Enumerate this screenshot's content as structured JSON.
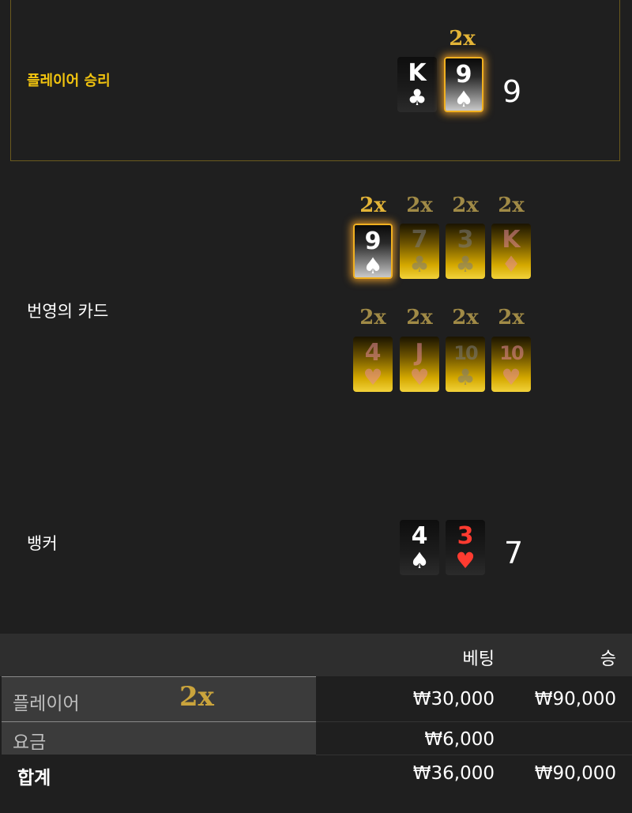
{
  "player": {
    "label": "플레이어 승리",
    "multiplier": "2x",
    "score": "9",
    "cards": [
      {
        "rank": "K",
        "suit": "♣",
        "style": "black",
        "color": "white"
      },
      {
        "rank": "9",
        "suit": "♠",
        "style": "silver",
        "color": "white"
      }
    ]
  },
  "lightning": {
    "label": "번영의 카드",
    "row1": [
      {
        "mult": "2x",
        "rank": "9",
        "suit": "♠",
        "style": "silver",
        "color": "white",
        "active": true
      },
      {
        "mult": "2x",
        "rank": "7",
        "suit": "♣",
        "style": "gold",
        "color": "grey",
        "active": false
      },
      {
        "mult": "2x",
        "rank": "3",
        "suit": "♣",
        "style": "gold",
        "color": "grey",
        "active": false
      },
      {
        "mult": "2x",
        "rank": "K",
        "suit": "♦",
        "style": "gold",
        "color": "pink",
        "active": false
      }
    ],
    "row2": [
      {
        "mult": "2x",
        "rank": "4",
        "suit": "♥",
        "style": "gold",
        "color": "pink",
        "active": false
      },
      {
        "mult": "2x",
        "rank": "J",
        "suit": "♥",
        "style": "gold",
        "color": "pink",
        "active": false
      },
      {
        "mult": "2x",
        "rank": "10",
        "suit": "♣",
        "style": "gold",
        "color": "grey",
        "active": false
      },
      {
        "mult": "2x",
        "rank": "10",
        "suit": "♥",
        "style": "gold",
        "color": "pink",
        "active": false
      }
    ]
  },
  "banker": {
    "label": "뱅커",
    "score": "7",
    "cards": [
      {
        "rank": "4",
        "suit": "♠",
        "style": "black",
        "color": "white"
      },
      {
        "rank": "3",
        "suit": "♥",
        "style": "black",
        "color": "red"
      }
    ]
  },
  "table": {
    "col_bet": "베팅",
    "col_win": "승",
    "rows": [
      {
        "label": "플레이어",
        "multiplier": "2x",
        "bet": "₩30,000",
        "win": "₩90,000"
      },
      {
        "label": "요금",
        "bet": "₩6,000",
        "win": ""
      }
    ],
    "total": {
      "label": "합계",
      "bet": "₩36,000",
      "win": "₩90,000"
    }
  }
}
